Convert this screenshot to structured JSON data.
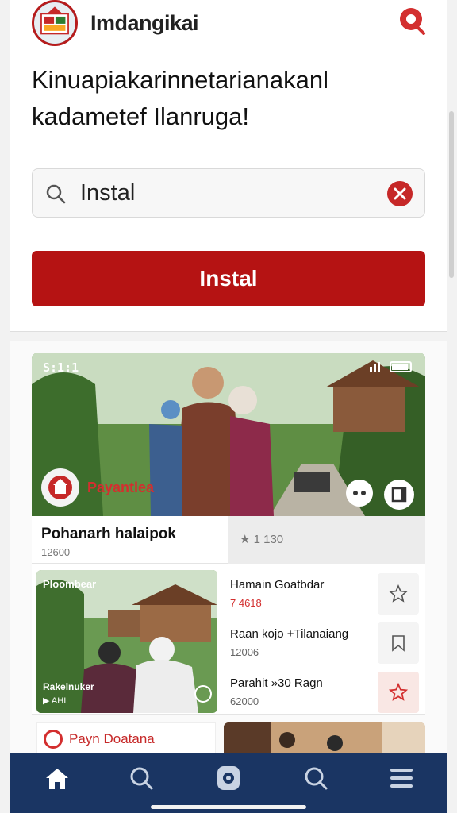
{
  "header": {
    "app_title": "Imdangikai",
    "headline": "Kinuapiakarinnetarianakanl kadametef Ilanruga!"
  },
  "search": {
    "value": "Instal"
  },
  "install_button": {
    "label": "Instal"
  },
  "hero": {
    "status_left": "S:1:1",
    "badge_label": "Payantlea"
  },
  "info": {
    "title": "Pohanarh halaipok",
    "subtitle": "12600",
    "rating": "★ 1 130"
  },
  "thumb": {
    "top_label": "Ploombear",
    "bottom_label": "Rakelnuker",
    "bottom_sub": "▶ AHI"
  },
  "list": [
    {
      "name": "Hamain Goatbdar",
      "meta": "7 4618",
      "meta_red": true,
      "starred": false
    },
    {
      "name": "Raan kojo +Tilanaiang",
      "meta": "12006",
      "meta_red": false,
      "starred": false
    },
    {
      "name": "Parahit »30 Ragn",
      "meta": "62000",
      "meta_red": false,
      "starred": true
    }
  ],
  "bottom": {
    "card_label": "Payn Doatana"
  },
  "nav": {
    "items": [
      "home-icon",
      "search-icon",
      "camera-icon",
      "search-icon",
      "menu-icon"
    ]
  },
  "colors": {
    "accent": "#b51313",
    "nav_bg": "#1a3563"
  }
}
